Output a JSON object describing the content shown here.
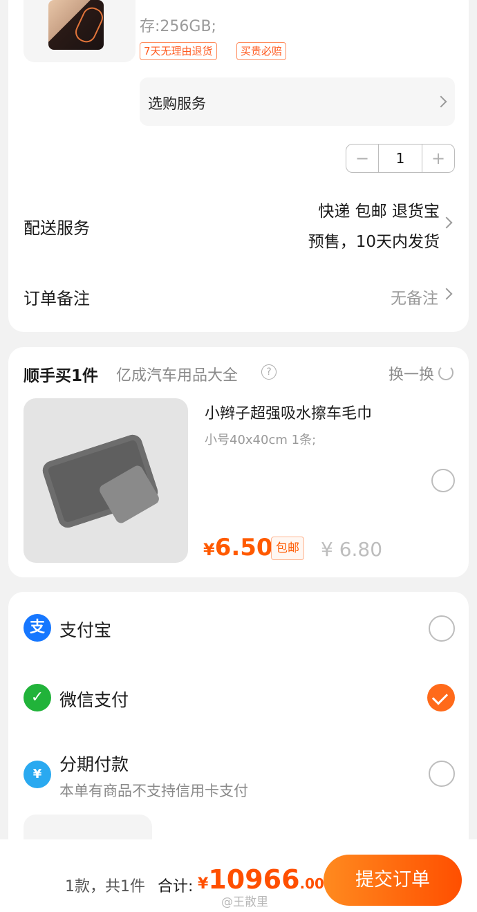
{
  "product": {
    "spec": "存:256GB;",
    "tags": [
      "7天无理由退货",
      "买贵必赔"
    ],
    "service_label": "选购服务",
    "quantity": "1",
    "minus": "−",
    "plus": "+"
  },
  "delivery": {
    "label": "配送服务",
    "line1": "快递 包邮 退货宝",
    "line2": "预售，10天内发货"
  },
  "note": {
    "label": "订单备注",
    "value": "无备注"
  },
  "addon": {
    "title": "顺手买1件",
    "shop": "亿成汽车用品大全",
    "help_symbol": "?",
    "swap": "换一换",
    "product_title": "小辫子超强吸水擦车毛巾",
    "product_spec": "小号40x40cm 1条;",
    "price_symbol": "¥",
    "price": "6.50",
    "shipping_tag": "包邮",
    "original_price": "¥ 6.80",
    "selected": false
  },
  "payment": {
    "options": [
      {
        "label": "支付宝",
        "icon": "alipay-icon",
        "icon_glyph": "支",
        "color": "#1677ff",
        "selected": false
      },
      {
        "label": "微信支付",
        "icon": "wechat-pay-icon",
        "icon_glyph": "✓",
        "color": "#21b33a",
        "selected": true
      },
      {
        "label": "分期付款",
        "icon": "installment-icon",
        "icon_glyph": "¥",
        "color": "#2aa9f0",
        "selected": false,
        "subtitle": "本单有商品不支持信用卡支付"
      }
    ]
  },
  "footer": {
    "summary": "1款，共1件",
    "total_label": "合计:",
    "currency": "¥",
    "total_int": "10966",
    "total_dec": ".00",
    "submit": "提交订单",
    "watermark": "@王散里"
  },
  "colors": {
    "accent": "#ff5a00",
    "selected": "#ff6a1a"
  }
}
